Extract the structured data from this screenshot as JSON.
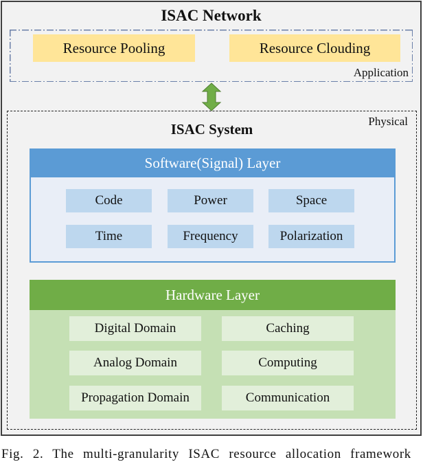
{
  "network": {
    "title": "ISAC Network",
    "application_label": "Application",
    "items": [
      "Resource Pooling",
      "Resource Clouding"
    ]
  },
  "connector": {
    "icon": "bidirectional-arrow-icon",
    "color": "#70ad47"
  },
  "system": {
    "title": "ISAC System",
    "physical_label": "Physical",
    "software_layer": {
      "title": "Software(Signal) Layer",
      "color": "#5b9bd5",
      "items": [
        "Code",
        "Power",
        "Space",
        "Time",
        "Frequency",
        "Polarization"
      ]
    },
    "hardware_layer": {
      "title": "Hardware Layer",
      "color": "#70ad47",
      "items": [
        "Digital Domain",
        "Caching",
        "Analog Domain",
        "Computing",
        "Propagation Domain",
        "Communication"
      ]
    }
  },
  "caption": "Fig. 2.  The multi-granularity ISAC resource allocation framework"
}
